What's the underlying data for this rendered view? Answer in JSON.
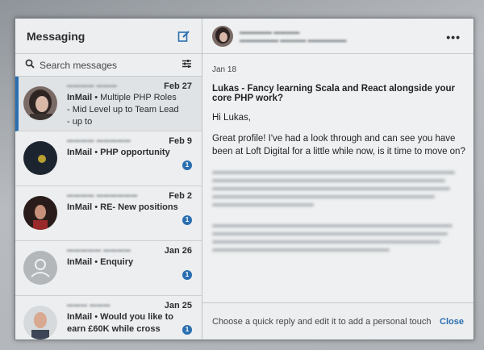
{
  "left": {
    "title": "Messaging",
    "search_placeholder": "Search messages"
  },
  "conversations": [
    {
      "date": "Feb 27",
      "type": "InMail",
      "snippet": "Multiple PHP Roles - Mid Level up to Team Lead - up to",
      "unread": ""
    },
    {
      "date": "Feb 9",
      "type": "InMail",
      "snippet": "PHP opportunity",
      "unread": "1"
    },
    {
      "date": "Feb 2",
      "type": "InMail",
      "snippet": "RE- New positions",
      "unread": "1"
    },
    {
      "date": "Jan 26",
      "type": "InMail",
      "snippet": "Enquiry",
      "unread": "1"
    },
    {
      "date": "Jan 25",
      "type": "InMail",
      "snippet": "Would you like to earn £60K while cross",
      "unread": "1"
    }
  ],
  "thread": {
    "date": "Jan 18",
    "subject": "Lukas - Fancy learning Scala and React alongside your core PHP work?",
    "greeting": "Hi Lukas,",
    "body": "Great profile! I've had a look through and can see you have been at Loft Digital for a little while now, is it time to move on?",
    "reply_hint": "Choose a quick reply and edit it to add a personal touch",
    "close_label": "Close"
  },
  "colors": {
    "accent": "#2a6fb0",
    "unread_badge": "#2a6fb0"
  }
}
